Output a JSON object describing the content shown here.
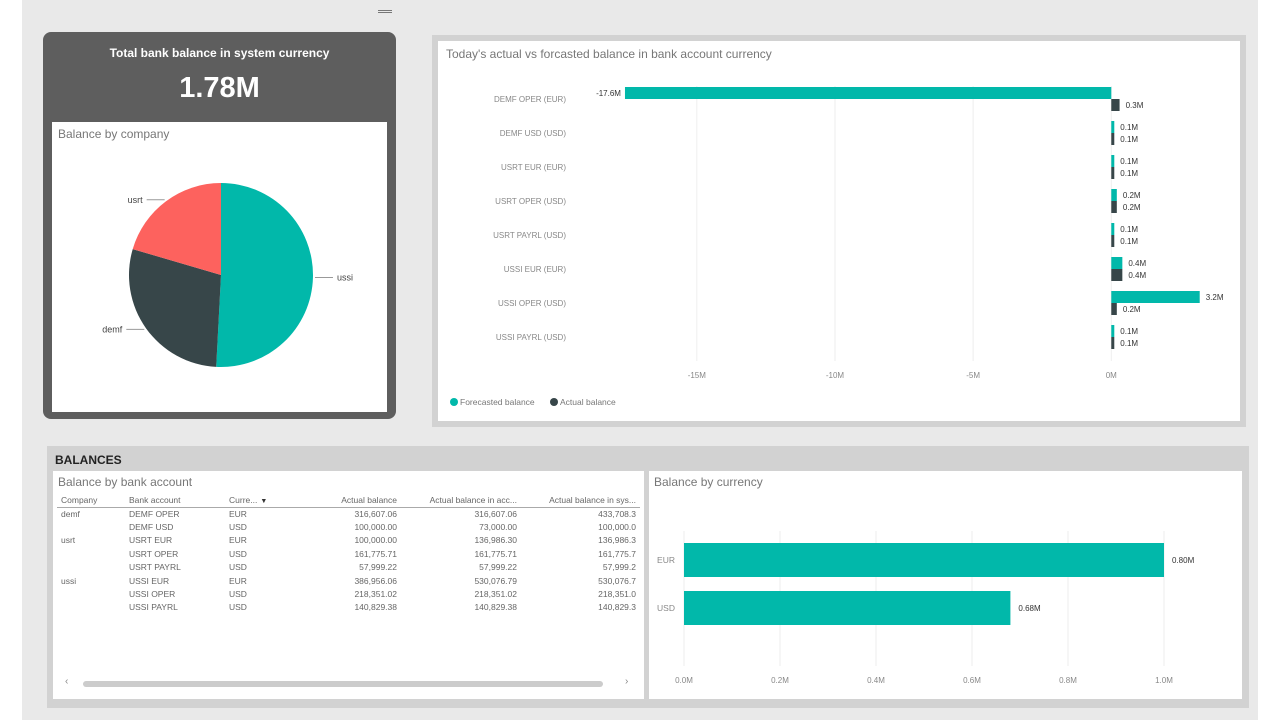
{
  "kpi": {
    "title": "Total bank balance in system currency",
    "value": "1.78M"
  },
  "pie": {
    "title": "Balance by company",
    "slices": [
      {
        "label": "ussi",
        "value": 0.887,
        "color": "#01b8aa"
      },
      {
        "label": "demf",
        "value": 0.501,
        "color": "#374649"
      },
      {
        "label": "usrt",
        "value": 0.357,
        "color": "#fd625e"
      }
    ]
  },
  "chart_data": [
    {
      "type": "bar",
      "title": "Today's actual vs forcasted balance in bank account currency",
      "categories": [
        "DEMF OPER (EUR)",
        "DEMF USD (USD)",
        "USRT EUR (EUR)",
        "USRT OPER (USD)",
        "USRT PAYRL (USD)",
        "USSI EUR (EUR)",
        "USSI OPER (USD)",
        "USSI PAYRL (USD)"
      ],
      "series": [
        {
          "name": "Forecasted balance",
          "color": "#01b8aa",
          "values": [
            -17.6,
            0.1,
            0.1,
            0.2,
            0.1,
            0.4,
            3.2,
            0.1
          ],
          "labels": [
            "-17.6M",
            "0.1M",
            "0.1M",
            "0.2M",
            "0.1M",
            "0.4M",
            "3.2M",
            "0.1M"
          ]
        },
        {
          "name": "Actual balance",
          "color": "#374649",
          "values": [
            0.3,
            0.1,
            0.1,
            0.2,
            0.1,
            0.4,
            0.2,
            0.1
          ],
          "labels": [
            "0.3M",
            "0.1M",
            "0.1M",
            "0.2M",
            "0.1M",
            "0.4M",
            "0.2M",
            "0.1M"
          ]
        }
      ],
      "xticks": [
        -15,
        -10,
        -5,
        0
      ],
      "xtick_labels": [
        "-15M",
        "-10M",
        "-5M",
        "0M"
      ],
      "xlim": [
        -19.3,
        3.5
      ],
      "legend": "bottom-left"
    },
    {
      "type": "bar",
      "title": "Balance by currency",
      "categories": [
        "EUR",
        "USD"
      ],
      "values": [
        1.0,
        0.68
      ],
      "value_labels": [
        "0.80M",
        "0.68M"
      ],
      "color": "#01b8aa",
      "xticks": [
        0,
        0.2,
        0.4,
        0.6,
        0.8,
        1.0
      ],
      "xtick_labels": [
        "0.0M",
        "0.2M",
        "0.4M",
        "0.6M",
        "0.8M",
        "1.0M"
      ],
      "xlim": [
        0,
        1.0
      ]
    }
  ],
  "balances": {
    "section_title": "BALANCES",
    "table_title": "Balance by bank account",
    "columns": [
      "Company",
      "Bank account",
      "Curre...",
      "Actual balance",
      "Actual balance in acc...",
      "Actual balance in sys..."
    ],
    "rows": [
      [
        "demf",
        "DEMF OPER",
        "EUR",
        "316,607.06",
        "316,607.06",
        "433,708.3"
      ],
      [
        "",
        "DEMF USD",
        "USD",
        "100,000.00",
        "73,000.00",
        "100,000.0"
      ],
      [
        "usrt",
        "USRT EUR",
        "EUR",
        "100,000.00",
        "136,986.30",
        "136,986.3"
      ],
      [
        "",
        "USRT OPER",
        "USD",
        "161,775.71",
        "161,775.71",
        "161,775.7"
      ],
      [
        "",
        "USRT PAYRL",
        "USD",
        "57,999.22",
        "57,999.22",
        "57,999.2"
      ],
      [
        "ussi",
        "USSI EUR",
        "EUR",
        "386,956.06",
        "530,076.79",
        "530,076.7"
      ],
      [
        "",
        "USSI OPER",
        "USD",
        "218,351.02",
        "218,351.02",
        "218,351.0"
      ],
      [
        "",
        "USSI PAYRL",
        "USD",
        "140,829.38",
        "140,829.38",
        "140,829.3"
      ]
    ]
  }
}
